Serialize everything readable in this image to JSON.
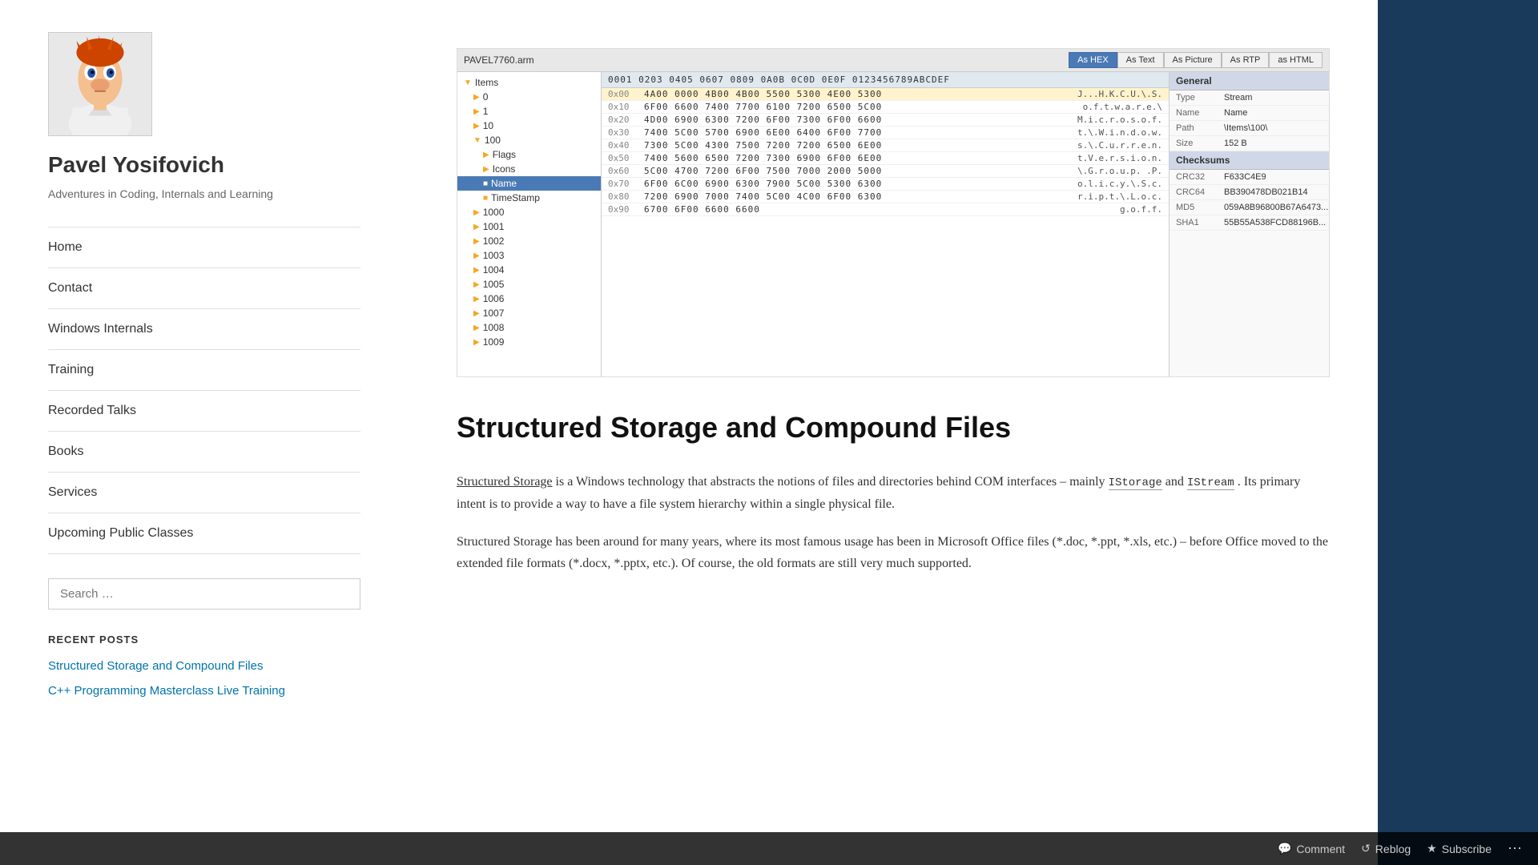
{
  "site": {
    "title": "Pavel Yosifovich",
    "description": "Adventures in Coding, Internals and Learning"
  },
  "nav": {
    "items": [
      {
        "label": "Home",
        "id": "home"
      },
      {
        "label": "Contact",
        "id": "contact"
      },
      {
        "label": "Windows Internals",
        "id": "windows-internals"
      },
      {
        "label": "Training",
        "id": "training"
      },
      {
        "label": "Recorded Talks",
        "id": "recorded-talks"
      },
      {
        "label": "Books",
        "id": "books"
      },
      {
        "label": "Services",
        "id": "services"
      },
      {
        "label": "Upcoming Public Classes",
        "id": "upcoming-classes"
      }
    ]
  },
  "search": {
    "placeholder": "Search …"
  },
  "recent_posts": {
    "heading": "RECENT POSTS",
    "items": [
      {
        "label": "Structured Storage and Compound Files",
        "id": "post-1"
      },
      {
        "label": "C++ Programming Masterclass Live Training",
        "id": "post-2"
      }
    ]
  },
  "viewer": {
    "title": "PAVEL7760.arm",
    "tabs": [
      "As HEX",
      "As Text",
      "As Picture",
      "As RTP",
      "as HTML"
    ],
    "active_tab": "As HEX",
    "tree": {
      "items": [
        {
          "label": "Items",
          "level": 0,
          "type": "folder",
          "expanded": true
        },
        {
          "label": "0",
          "level": 1,
          "type": "folder"
        },
        {
          "label": "1",
          "level": 1,
          "type": "folder"
        },
        {
          "label": "10",
          "level": 1,
          "type": "folder"
        },
        {
          "label": "100",
          "level": 1,
          "type": "folder",
          "expanded": true
        },
        {
          "label": "Flags",
          "level": 2,
          "type": "folder"
        },
        {
          "label": "Icons",
          "level": 2,
          "type": "folder"
        },
        {
          "label": "Name",
          "level": 2,
          "type": "item",
          "selected": true
        },
        {
          "label": "TimeStamp",
          "level": 2,
          "type": "item"
        },
        {
          "label": "1000",
          "level": 1,
          "type": "folder"
        },
        {
          "label": "1001",
          "level": 1,
          "type": "folder"
        },
        {
          "label": "1002",
          "level": 1,
          "type": "folder"
        },
        {
          "label": "1003",
          "level": 1,
          "type": "folder"
        },
        {
          "label": "1004",
          "level": 1,
          "type": "folder"
        },
        {
          "label": "1005",
          "level": 1,
          "type": "folder"
        },
        {
          "label": "1006",
          "level": 1,
          "type": "folder"
        },
        {
          "label": "1007",
          "level": 1,
          "type": "folder"
        },
        {
          "label": "1008",
          "level": 1,
          "type": "folder"
        },
        {
          "label": "1009",
          "level": 1,
          "type": "folder"
        }
      ]
    },
    "hex_header": "0001 0203 0405 0607 0809 0A0B 0C0D 0E0F  0123456789ABCDEF",
    "hex_rows": [
      {
        "offset": "0x00",
        "bytes": "4A00 0000 4B00 4B00 5500 5300 4E00 5300",
        "ascii": "J...H.K.C.U.\\.S.",
        "highlight": true
      },
      {
        "offset": "0x10",
        "bytes": "6F00 6600 7400 7700 6100 7200 6500 5C00",
        "ascii": "o.f.t.w.a.r.e.\\"
      },
      {
        "offset": "0x20",
        "bytes": "4D00 6900 6300 7200 6F00 7300 6F00 6600",
        "ascii": "M.i.c.r.o.s.o.f."
      },
      {
        "offset": "0x30",
        "bytes": "7400 5C00 5700 6900 6E00 6400 6F00 7700",
        "ascii": "t.\\.W.i.n.d.o.w."
      },
      {
        "offset": "0x40",
        "bytes": "7300 5C00 4300 7500 7200 7200 6500 6E00",
        "ascii": "s.\\.C.u.r.r.e.n."
      },
      {
        "offset": "0x50",
        "bytes": "7400 5600 6500 7200 7300 6900 6F00 6E00",
        "ascii": "t.V.e.r.s.i.o.n."
      },
      {
        "offset": "0x60",
        "bytes": "5C00 4700 7200 6F00 7500 7000 2000 5000",
        "ascii": "\\.G.r.o.u.p. .P."
      },
      {
        "offset": "0x70",
        "bytes": "6F00 6C00 6900 6300 7900 5C00 5300 6300",
        "ascii": "o.l.i.c.y.\\.S.c."
      },
      {
        "offset": "0x80",
        "bytes": "7200 6900 7000 7400 5C00 4C00 6F00 6300",
        "ascii": "r.i.p.t.\\.L.o.c."
      },
      {
        "offset": "0x90",
        "bytes": "6700 6F00 6600 6600",
        "ascii": "g.o.f.f."
      }
    ],
    "info_panel": {
      "general_label": "General",
      "general": [
        {
          "label": "Type",
          "value": "Stream"
        },
        {
          "label": "Name",
          "value": "Name"
        },
        {
          "label": "Path",
          "value": "\\Items\\100\\"
        },
        {
          "label": "Size",
          "value": "152 B"
        }
      ],
      "checksums_label": "Checksums",
      "checksums": [
        {
          "label": "CRC32",
          "value": "F633C4E9"
        },
        {
          "label": "CRC64",
          "value": "BB390478DB021B14"
        },
        {
          "label": "MD5",
          "value": "059A8B96800B67A6473..."
        },
        {
          "label": "SHA1",
          "value": "55B55A538FCD88196B..."
        }
      ]
    }
  },
  "article": {
    "title": "Structured Storage and Compound Files",
    "paragraphs": [
      {
        "text": "Structured Storage is a Windows technology that abstracts the notions of files and directories behind COM interfaces – mainly IStorage and IStream. Its primary intent is to provide a way to have a file system hierarchy within a single physical file.",
        "links": [
          "Structured Storage"
        ],
        "codes": [
          "IStorage",
          "IStream"
        ]
      },
      {
        "text": "Structured Storage has been around for many years, where its most famous usage has been in Microsoft Office files (*.doc, *.ppt, *.xls, etc.) – before Office moved to the extended file formats (*.docx, *.pptx, etc.). Of course, the old formats are still very much supported.",
        "links": [],
        "codes": []
      }
    ]
  },
  "bottom_bar": {
    "comment_label": "Comment",
    "reblog_label": "Reblog",
    "subscribe_label": "Subscribe"
  },
  "colors": {
    "accent_blue": "#4a7ab5",
    "dark_navy": "#1a3a5c",
    "link_color": "#0073aa"
  }
}
